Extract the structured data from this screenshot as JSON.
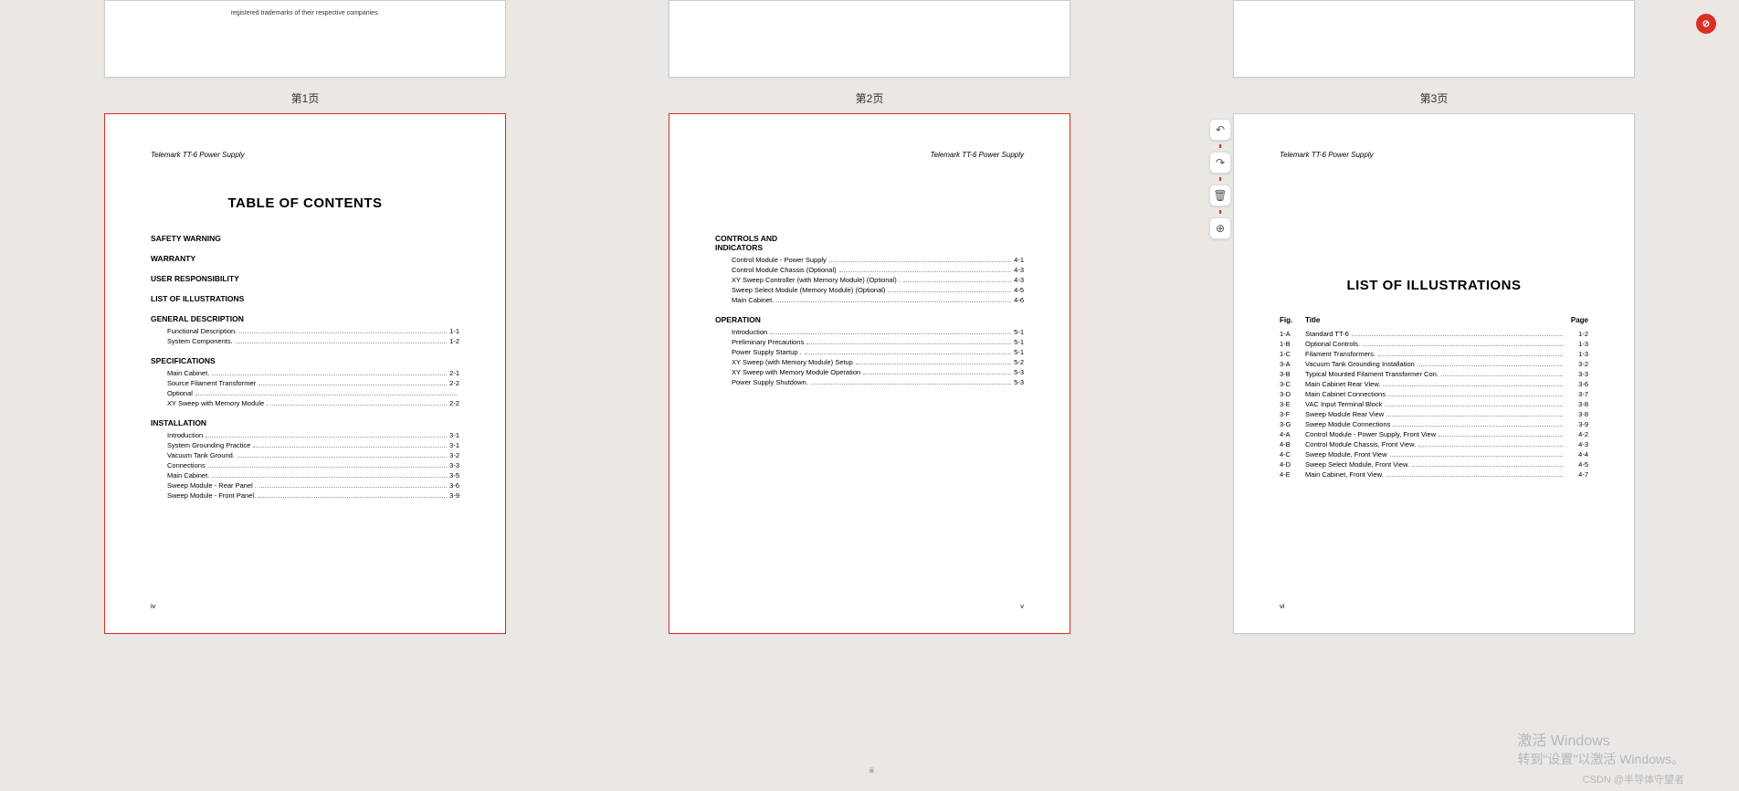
{
  "labels": {
    "p1": "第1页",
    "p2": "第2页",
    "p3": "第3页"
  },
  "doc_header": "Telemark TT-6 Power Supply",
  "frag_text": "registered trademarks of their respective companies.",
  "toc": {
    "title": "TABLE OF CONTENTS",
    "top": [
      "SAFETY WARNING",
      "WARRANTY",
      "USER RESPONSIBILITY",
      "LIST OF ILLUSTRATIONS"
    ],
    "sections": [
      {
        "name": "GENERAL DESCRIPTION",
        "items": [
          {
            "t": "Functional Description.",
            "p": "1-1"
          },
          {
            "t": "System Components.",
            "p": "1-2"
          }
        ]
      },
      {
        "name": "SPECIFICATIONS",
        "items": [
          {
            "t": "Main Cabinet.",
            "p": "2-1"
          },
          {
            "t": "Source Filament Transformer",
            "p": "2-2"
          },
          {
            "t": "Optional",
            "p": ""
          },
          {
            "t": "XY Sweep with Memory Module .",
            "p": "2-2"
          }
        ]
      },
      {
        "name": "INSTALLATION",
        "items": [
          {
            "t": "Introduction",
            "p": "3-1"
          },
          {
            "t": "System Grounding Practice",
            "p": "3-1"
          },
          {
            "t": "Vacuum Tank Ground.",
            "p": "3-2"
          },
          {
            "t": "Connections",
            "p": "3-3"
          },
          {
            "t": "Main Cabinet.",
            "p": "3-5"
          },
          {
            "t": "Sweep Module - Rear Panel .",
            "p": "3-6"
          },
          {
            "t": "Sweep Module - Front Panel.",
            "p": "3-9"
          }
        ]
      }
    ],
    "pnum": "iv"
  },
  "toc2": {
    "sections": [
      {
        "name": "CONTROLS AND INDICATORS",
        "items": [
          {
            "t": "Control Module - Power Supply",
            "p": "4-1"
          },
          {
            "t": "Control Module Chassis (Optional)",
            "p": "4-3"
          },
          {
            "t": "XY Sweep Controller (with Memory Module) (Optional) .",
            "p": "4-3"
          },
          {
            "t": "Sweep Select Module (Memory Module) (Optional)",
            "p": "4-5"
          },
          {
            "t": "Main Cabinet.",
            "p": "4-6"
          }
        ]
      },
      {
        "name": "OPERATION",
        "items": [
          {
            "t": "Introduction",
            "p": "5-1"
          },
          {
            "t": "Preliminary Precautions",
            "p": "5-1"
          },
          {
            "t": "Power Supply Startup .",
            "p": "5-1"
          },
          {
            "t": "XY Sweep (with Memory Module) Setup",
            "p": "5-2"
          },
          {
            "t": "XY Sweep with Memory Module Operation",
            "p": "5-3"
          },
          {
            "t": "Power Supply Shutdown.",
            "p": "5-3"
          }
        ]
      }
    ],
    "pnum": "v"
  },
  "loi": {
    "title": "LIST OF ILLUSTRATIONS",
    "head": {
      "c1": "Fig.",
      "c2": "Title",
      "c3": "Page"
    },
    "rows": [
      {
        "f": "1-A",
        "t": "Standard TT-6",
        "p": "1-2"
      },
      {
        "f": "1-B",
        "t": "Optional Controls.",
        "p": "1-3"
      },
      {
        "f": "1-C",
        "t": "Filament Transformers.",
        "p": "1-3"
      },
      {
        "f": "3-A",
        "t": "Vacuum Tank Grounding Installation",
        "p": "3-2"
      },
      {
        "f": "3-B",
        "t": "Typical Mounted Filament Transformer Con.",
        "p": "3-3"
      },
      {
        "f": "3-C",
        "t": "Main Cabinet Rear View.",
        "p": "3-6"
      },
      {
        "f": "3-D",
        "t": "Main Cabinet Connections",
        "p": "3-7"
      },
      {
        "f": "3-E",
        "t": "VAC Input Terminal Block",
        "p": "3-8"
      },
      {
        "f": "3-F",
        "t": "Sweep Module Rear View",
        "p": "3-8"
      },
      {
        "f": "3-G",
        "t": "Sweep Module Connections",
        "p": "3-9"
      },
      {
        "f": "4-A",
        "t": "Control Module - Power Supply, Front View",
        "p": "4-2"
      },
      {
        "f": "4-B",
        "t": "Control Module Chassis, Front View.",
        "p": "4-3"
      },
      {
        "f": "4-C",
        "t": "Sweep Module, Front View",
        "p": "4-4"
      },
      {
        "f": "4-D",
        "t": "Sweep Select Module, Front View.",
        "p": "4-5"
      },
      {
        "f": "4-E",
        "t": "Main Cabinet, Front View.",
        "p": "4-7"
      }
    ],
    "pnum": "vi"
  },
  "wm": {
    "l1": "激活 Windows",
    "l2": "转到\"设置\"以激活 Windows。"
  },
  "csdn": "CSDN @半导体守望者"
}
